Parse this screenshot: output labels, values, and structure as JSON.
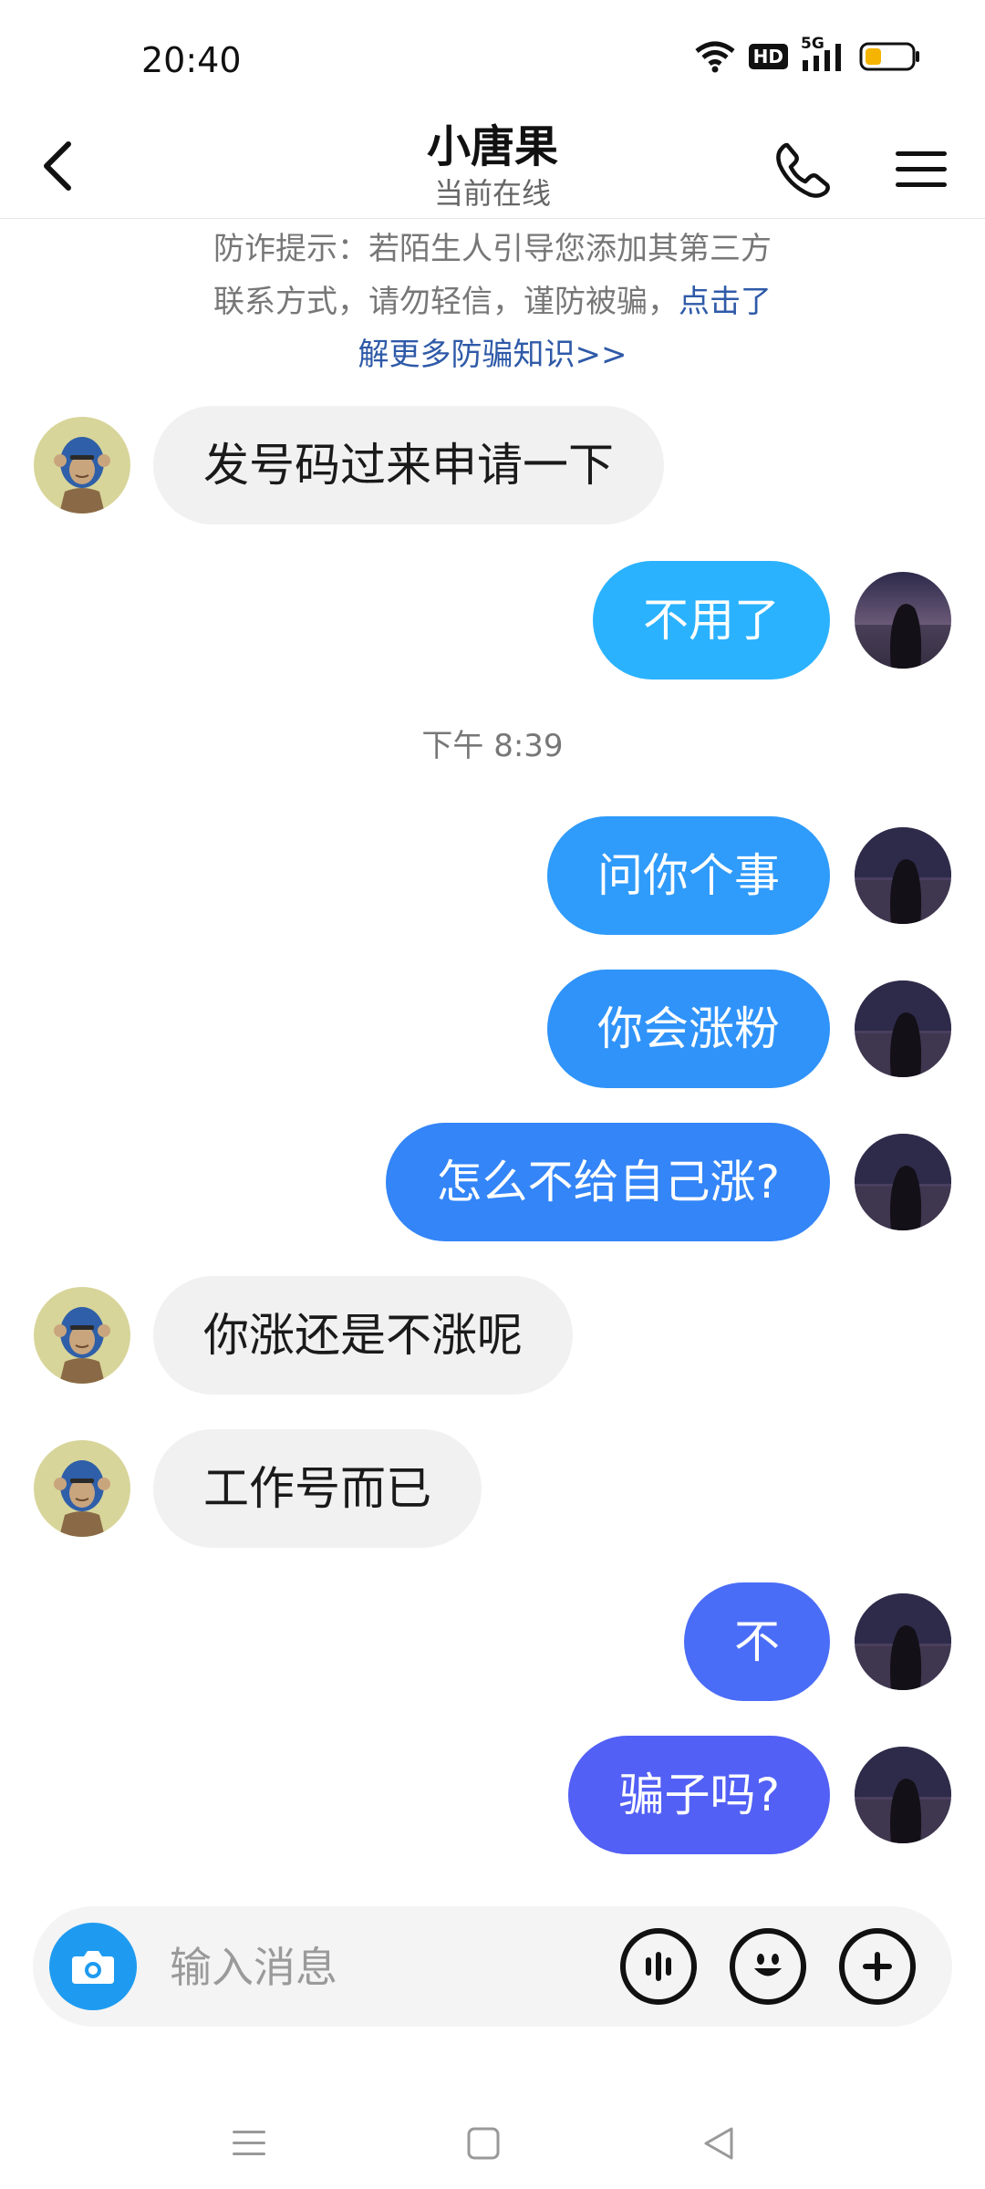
{
  "status_bar": {
    "time": "20:40",
    "network": "5G",
    "hd_label": "HD",
    "battery_color": "#f5b400"
  },
  "header": {
    "title": "小唐果",
    "subtitle": "当前在线"
  },
  "notice": {
    "text": "防诈提示：若陌生人引导您添加其第三方联系方式，请勿轻信，谨防被骗，",
    "link": "点击了解更多防骗知识>>"
  },
  "timestamp": "下午 8:39",
  "messages": [
    {
      "side": "left",
      "text": "发号码过来申请一下"
    },
    {
      "side": "right",
      "text": "不用了",
      "color": "#2ab2ff"
    },
    {
      "side": "right",
      "text": "问你个事",
      "color": "#2f9bfb"
    },
    {
      "side": "right",
      "text": "你会涨粉",
      "color": "#2f93fa"
    },
    {
      "side": "right",
      "text": "怎么不给自己涨?",
      "color": "#3385f8"
    },
    {
      "side": "left",
      "text": "你涨还是不涨呢"
    },
    {
      "side": "left",
      "text": "工作号而已"
    },
    {
      "side": "right",
      "text": "不",
      "color": "#4a6df7"
    },
    {
      "side": "right",
      "text": "骗子吗?",
      "color": "#5260f5"
    }
  ],
  "input": {
    "placeholder": "输入消息"
  },
  "icons": [
    "back-arrow",
    "phone",
    "menu",
    "camera",
    "voice",
    "emoji",
    "plus",
    "nav-menu",
    "nav-home",
    "nav-back"
  ]
}
